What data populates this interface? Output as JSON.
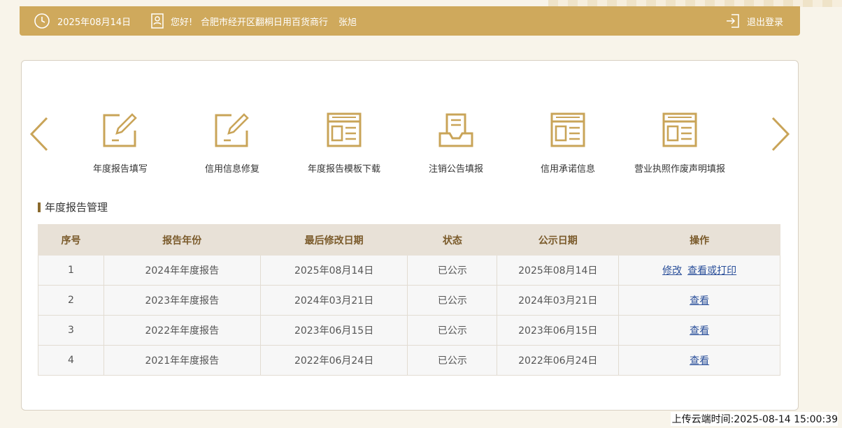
{
  "header": {
    "date": "2025年08月14日",
    "greeting": "您好!",
    "company": "合肥市经开区翻桐日用百货商行",
    "user_name": "张旭",
    "logout_label": "退出登录"
  },
  "functions": [
    {
      "label": "年度报告填写",
      "icon": "edit-form-icon"
    },
    {
      "label": "信用信息修复",
      "icon": "edit-form-icon"
    },
    {
      "label": "年度报告模板下载",
      "icon": "document-window-icon"
    },
    {
      "label": "注销公告填报",
      "icon": "inbox-document-icon"
    },
    {
      "label": "信用承诺信息",
      "icon": "document-window-icon"
    },
    {
      "label": "营业执照作废声明填报",
      "icon": "document-window-icon"
    }
  ],
  "section": {
    "title": "年度报告管理"
  },
  "table": {
    "headers": [
      "序号",
      "报告年份",
      "最后修改日期",
      "状态",
      "公示日期",
      "操作"
    ],
    "rows": [
      {
        "no": "1",
        "year": "2024年年度报告",
        "modified": "2025年08月14日",
        "status": "已公示",
        "published": "2025年08月14日",
        "actions": [
          "修改",
          "查看或打印"
        ]
      },
      {
        "no": "2",
        "year": "2023年年度报告",
        "modified": "2024年03月21日",
        "status": "已公示",
        "published": "2024年03月21日",
        "actions": [
          "查看"
        ]
      },
      {
        "no": "3",
        "year": "2022年年度报告",
        "modified": "2023年06月15日",
        "status": "已公示",
        "published": "2023年06月15日",
        "actions": [
          "查看"
        ]
      },
      {
        "no": "4",
        "year": "2021年年度报告",
        "modified": "2022年06月24日",
        "status": "已公示",
        "published": "2022年06月24日",
        "actions": [
          "查看"
        ]
      }
    ]
  },
  "footer": {
    "upload_time": "上传云端时间:2025-08-14 15:00:39"
  },
  "colors": {
    "brand_gold": "#cfa95c",
    "link_blue": "#2a4f9a",
    "header_bg": "#e8e1d7"
  }
}
